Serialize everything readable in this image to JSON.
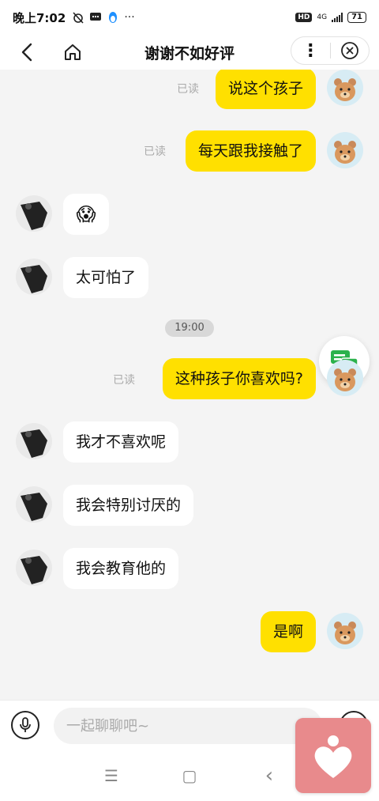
{
  "status_bar": {
    "time": "晚上7:02",
    "hd": "HD",
    "network": "4G",
    "battery": "71"
  },
  "header": {
    "title": "谢谢不如好评",
    "more_label": "⋮"
  },
  "messages": [
    {
      "side": "me",
      "text": "说这个孩子",
      "read": "已读"
    },
    {
      "side": "me",
      "text": "每天跟我接触了",
      "read": "已读"
    },
    {
      "side": "other",
      "text": "😱",
      "emoji": true
    },
    {
      "side": "other",
      "text": "太可怕了"
    },
    {
      "side": "me",
      "text": "这种孩子你喜欢吗?",
      "read": "已读"
    },
    {
      "side": "other",
      "text": "我才不喜欢呢"
    },
    {
      "side": "other",
      "text": "我会特别讨厌的"
    },
    {
      "side": "other",
      "text": "我会教育他的"
    },
    {
      "side": "me",
      "text": "是啊"
    }
  ],
  "timestamp": "19:00",
  "input": {
    "placeholder": "一起聊聊吧~"
  },
  "nav": {
    "menu": "☰",
    "home": "▢",
    "back": "‹"
  },
  "colors": {
    "my_bubble": "#ffe000",
    "other_bubble": "#ffffff",
    "background": "#f4f4f4",
    "float_icon": "#2bb24c",
    "badge": "#e88a8c"
  }
}
